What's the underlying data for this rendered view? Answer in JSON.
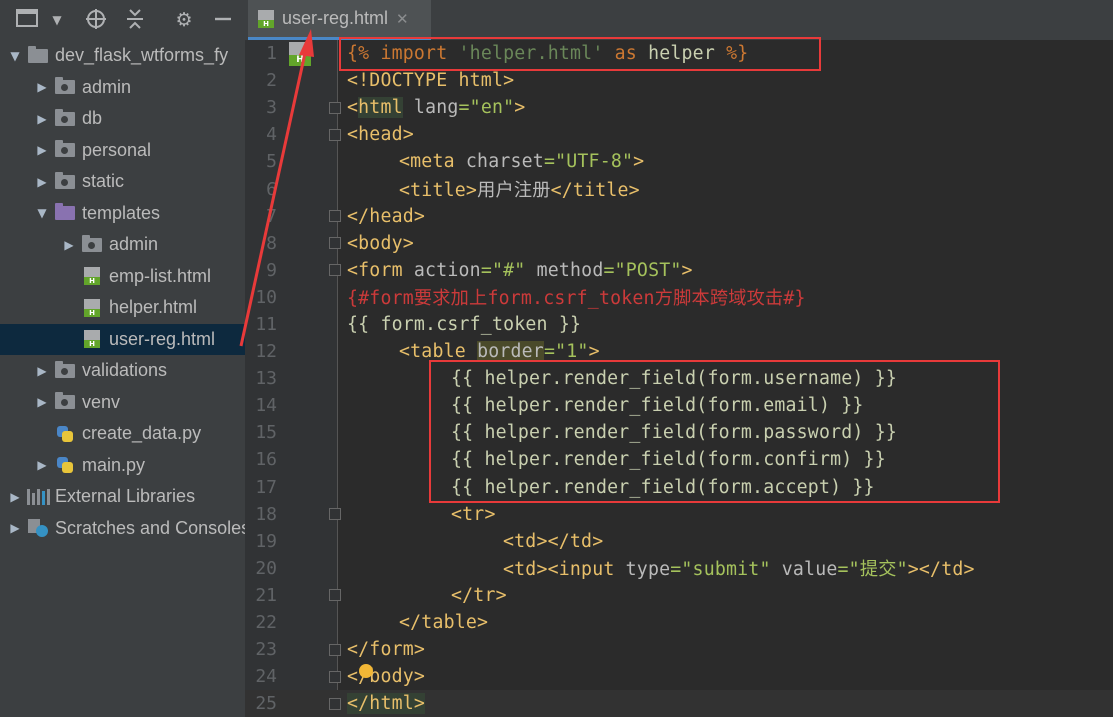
{
  "toolbar": {
    "project_view_icon": "project-view-icon",
    "dropdown_icon": "triangle-down-icon",
    "locate_icon": "crosshair-icon",
    "collapse_icon": "collapse-icon",
    "settings_icon": "gear-icon",
    "hide_icon": "minus-icon"
  },
  "project_tree": [
    {
      "label": "dev_flask_wtforms_fy",
      "arrow": "▼",
      "icon": "folder",
      "indent": 0
    },
    {
      "label": "admin",
      "arrow": "▶",
      "icon": "folder-dot",
      "indent": 1
    },
    {
      "label": "db",
      "arrow": "▶",
      "icon": "folder-dot",
      "indent": 1
    },
    {
      "label": "personal",
      "arrow": "▶",
      "icon": "folder-dot",
      "indent": 1
    },
    {
      "label": "static",
      "arrow": "▶",
      "icon": "folder-dot",
      "indent": 1
    },
    {
      "label": "templates",
      "arrow": "▼",
      "icon": "folder-purple",
      "indent": 1
    },
    {
      "label": "admin",
      "arrow": "▶",
      "icon": "folder-dot",
      "indent": 2
    },
    {
      "label": "emp-list.html",
      "arrow": "",
      "icon": "html",
      "indent": 2
    },
    {
      "label": "helper.html",
      "arrow": "",
      "icon": "html",
      "indent": 2
    },
    {
      "label": "user-reg.html",
      "arrow": "",
      "icon": "html",
      "indent": 2,
      "selected": true
    },
    {
      "label": "validations",
      "arrow": "▶",
      "icon": "folder-dot",
      "indent": 1
    },
    {
      "label": "venv",
      "arrow": "▶",
      "icon": "folder-dot",
      "indent": 1
    },
    {
      "label": "create_data.py",
      "arrow": "",
      "icon": "python",
      "indent": 1
    },
    {
      "label": "main.py",
      "arrow": "▶",
      "icon": "python",
      "indent": 1
    },
    {
      "label": "External Libraries",
      "arrow": "▶",
      "icon": "libraries",
      "indent": 0
    },
    {
      "label": "Scratches and Consoles",
      "arrow": "▶",
      "icon": "scratches",
      "indent": 0
    }
  ],
  "editor": {
    "tab_label": "user-reg.html",
    "tab_close": "✕",
    "file_badge": "H",
    "lines": [
      {
        "n": "1",
        "indent": 0,
        "segments": [
          [
            "t-kw",
            "{% "
          ],
          [
            "t-kw",
            "import "
          ],
          [
            "t-str",
            "'helper.html'"
          ],
          [
            "t-kw",
            " as "
          ],
          [
            "t-var",
            "helper"
          ],
          [
            "t-kw",
            " %}"
          ]
        ]
      },
      {
        "n": "2",
        "indent": 0,
        "segments": [
          [
            "t-doc",
            "<!DOCTYPE "
          ],
          [
            "t-tag",
            "html"
          ],
          [
            "t-doc",
            ">"
          ]
        ]
      },
      {
        "n": "3",
        "indent": 0,
        "segments": [
          [
            "t-tag",
            "<"
          ],
          [
            "t-tag hl",
            "html"
          ],
          [
            "t-attr",
            " lang"
          ],
          [
            "t-val",
            "=\"en\""
          ],
          [
            "t-tag",
            ">"
          ]
        ]
      },
      {
        "n": "4",
        "indent": 0,
        "segments": [
          [
            "t-tag",
            "<head>"
          ]
        ]
      },
      {
        "n": "5",
        "indent": 1,
        "segments": [
          [
            "t-tag",
            "<meta"
          ],
          [
            "t-attr",
            " charset"
          ],
          [
            "t-val",
            "=\"UTF-8\""
          ],
          [
            "t-tag",
            ">"
          ]
        ]
      },
      {
        "n": "6",
        "indent": 1,
        "segments": [
          [
            "t-tag",
            "<title>"
          ],
          [
            "t-attr",
            "用户注册"
          ],
          [
            "t-tag",
            "</title>"
          ]
        ]
      },
      {
        "n": "7",
        "indent": 0,
        "segments": [
          [
            "t-tag",
            "</head>"
          ]
        ]
      },
      {
        "n": "8",
        "indent": 0,
        "segments": [
          [
            "t-tag",
            "<body>"
          ]
        ]
      },
      {
        "n": "9",
        "indent": 0,
        "segments": [
          [
            "t-tag",
            "<form"
          ],
          [
            "t-attr",
            " action"
          ],
          [
            "t-val",
            "=\"#\""
          ],
          [
            "t-attr",
            " method"
          ],
          [
            "t-val",
            "=\"POST\""
          ],
          [
            "t-tag",
            ">"
          ]
        ]
      },
      {
        "n": "10",
        "indent": 0,
        "segments": [
          [
            "t-cmt",
            "{#form要求加上form.csrf_token方脚本跨域攻击#}"
          ]
        ]
      },
      {
        "n": "11",
        "indent": 0,
        "segments": [
          [
            "t-var",
            "{{ form.csrf_token }}"
          ]
        ]
      },
      {
        "n": "12",
        "indent": 1,
        "segments": [
          [
            "t-tag",
            "<table "
          ],
          [
            "t-attr hl2",
            "border"
          ],
          [
            "t-val",
            "=\"1\""
          ],
          [
            "t-tag",
            ">"
          ]
        ]
      },
      {
        "n": "13",
        "indent": 2,
        "segments": [
          [
            "t-var",
            "{{ helper.render_field(form.username) }}"
          ]
        ]
      },
      {
        "n": "14",
        "indent": 2,
        "segments": [
          [
            "t-var",
            "{{ helper.render_field(form.email) }}"
          ]
        ]
      },
      {
        "n": "15",
        "indent": 2,
        "segments": [
          [
            "t-var",
            "{{ helper.render_field(form.password) }}"
          ]
        ]
      },
      {
        "n": "16",
        "indent": 2,
        "segments": [
          [
            "t-var",
            "{{ helper.render_field(form.confirm) }}"
          ]
        ]
      },
      {
        "n": "17",
        "indent": 2,
        "segments": [
          [
            "t-var",
            "{{ helper.render_field(form.accept) }}"
          ]
        ]
      },
      {
        "n": "18",
        "indent": 2,
        "segments": [
          [
            "t-tag",
            "<tr>"
          ]
        ]
      },
      {
        "n": "19",
        "indent": 3,
        "segments": [
          [
            "t-tag",
            "<td></td>"
          ]
        ]
      },
      {
        "n": "20",
        "indent": 3,
        "segments": [
          [
            "t-tag",
            "<td><input"
          ],
          [
            "t-attr",
            " type"
          ],
          [
            "t-val",
            "=\"submit\""
          ],
          [
            "t-attr",
            " value"
          ],
          [
            "t-val",
            "=\"提交\""
          ],
          [
            "t-tag",
            "></td>"
          ]
        ]
      },
      {
        "n": "21",
        "indent": 2,
        "segments": [
          [
            "t-tag",
            "</tr>"
          ]
        ]
      },
      {
        "n": "22",
        "indent": 1,
        "segments": [
          [
            "t-tag",
            "</table>"
          ]
        ]
      },
      {
        "n": "23",
        "indent": 0,
        "segments": [
          [
            "t-tag",
            "</form>"
          ]
        ]
      },
      {
        "n": "24",
        "indent": 0,
        "segments": [
          [
            "t-tag",
            "</body>"
          ]
        ]
      },
      {
        "n": "25",
        "indent": 0,
        "segments": [
          [
            "t-tag hl",
            "</html>"
          ]
        ]
      }
    ]
  },
  "annotation_color": "#e83a3a"
}
